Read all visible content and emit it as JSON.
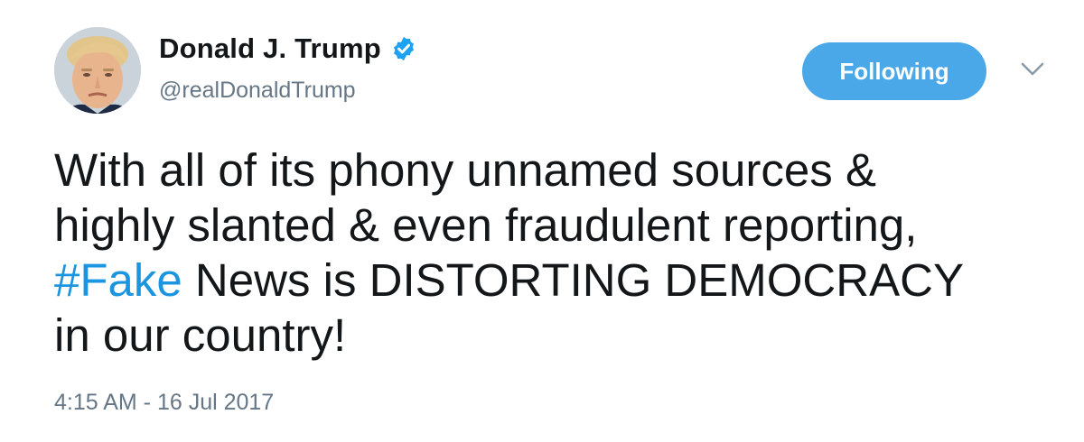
{
  "author": {
    "display_name": "Donald J. Trump",
    "handle": "@realDonaldTrump",
    "verified": true,
    "avatar_icon": "profile-photo"
  },
  "follow_button": {
    "label": "Following"
  },
  "menu": {
    "icon": "chevron-down-icon"
  },
  "tweet": {
    "text_line1": "With all of its phony unnamed sources &",
    "text_line2": "highly slanted & even fraudulent reporting,",
    "hashtag": "#Fake",
    "text_line3_rest": " News is DISTORTING DEMOCRACY",
    "text_line4": "in our country!",
    "timestamp": "4:15 AM - 16 Jul 2017"
  },
  "colors": {
    "button_bg": "#4aa8e8",
    "hashtag": "#1b95e0",
    "verified": "#1da1f2",
    "secondary_text": "#657786",
    "primary_text": "#14171a"
  }
}
